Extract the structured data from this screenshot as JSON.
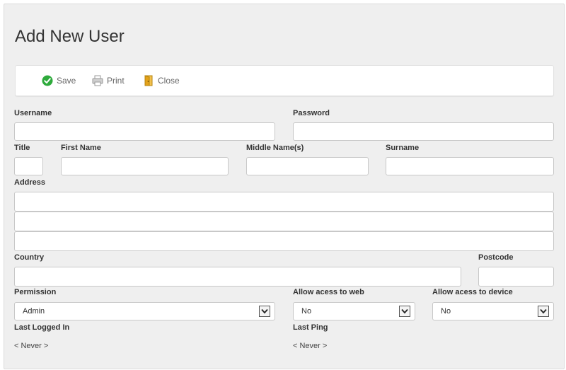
{
  "page": {
    "title": "Add New User"
  },
  "toolbar": {
    "save_label": "Save",
    "print_label": "Print",
    "close_label": "Close"
  },
  "form": {
    "username": {
      "label": "Username",
      "value": ""
    },
    "password": {
      "label": "Password",
      "value": ""
    },
    "title": {
      "label": "Title",
      "value": ""
    },
    "first_name": {
      "label": "First Name",
      "value": ""
    },
    "middle_names": {
      "label": "Middle Name(s)",
      "value": ""
    },
    "surname": {
      "label": "Surname",
      "value": ""
    },
    "address": {
      "label": "Address",
      "line1": "",
      "line2": "",
      "line3": ""
    },
    "country": {
      "label": "Country",
      "value": ""
    },
    "postcode": {
      "label": "Postcode",
      "value": ""
    },
    "permission": {
      "label": "Permission",
      "value": "Admin"
    },
    "web_access": {
      "label": "Allow acess to web",
      "value": "No"
    },
    "device_access": {
      "label": "Allow acess to device",
      "value": "No"
    },
    "last_logged_in": {
      "label": "Last Logged In",
      "value": "< Never >"
    },
    "last_ping": {
      "label": "Last Ping",
      "value": "< Never >"
    }
  },
  "icons": {
    "save": "check-circle-icon",
    "print": "printer-icon",
    "close": "door-icon"
  },
  "colors": {
    "panel_bg": "#efefef",
    "save_icon": "#2eaa3c",
    "close_icon": "#e3a21a"
  }
}
